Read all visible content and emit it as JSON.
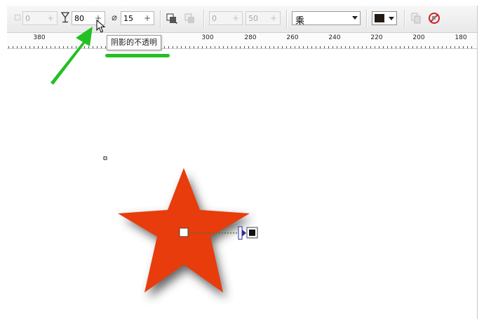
{
  "toolbar": {
    "shadow_offset_value": "0",
    "shadow_opacity_value": "80",
    "shadow_feather_value": "15",
    "shadow_stretch_value": "0",
    "shadow_fade_value": "50",
    "merge_mode": "乘",
    "shadow_color": "#231a14"
  },
  "tooltip": {
    "text": "阴影的不透明"
  },
  "ruler": {
    "labels": [
      "380",
      "300",
      "280",
      "260",
      "240",
      "220",
      "200",
      "180"
    ]
  },
  "canvas": {
    "star_color": "#e83c0c",
    "annotation_color": "#22c022"
  }
}
